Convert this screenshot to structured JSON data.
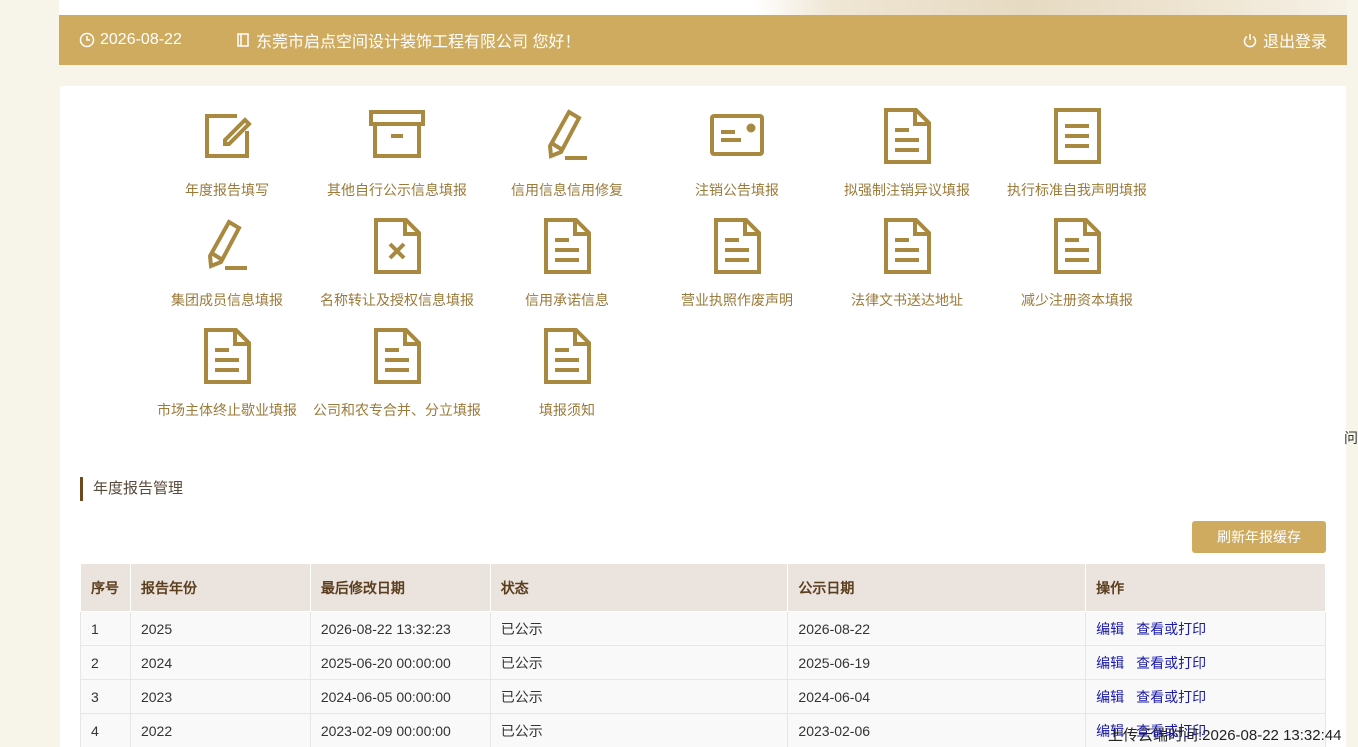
{
  "header": {
    "date": "2026-08-22",
    "company_greeting": "东莞市启点空间设计装饰工程有限公司 您好！",
    "logout_label": "退出登录",
    "background_color": "#cfab60"
  },
  "tiles": [
    {
      "label": "年度报告填写",
      "icon": "edit-icon"
    },
    {
      "label": "其他自行公示信息填报",
      "icon": "archive-icon"
    },
    {
      "label": "信用信息信用修复",
      "icon": "pencil-icon"
    },
    {
      "label": "注销公告填报",
      "icon": "card-icon"
    },
    {
      "label": "拟强制注销异议填报",
      "icon": "document-icon"
    },
    {
      "label": "执行标准自我声明填报",
      "icon": "document-icon"
    },
    {
      "label": "集团成员信息填报",
      "icon": "pencil-icon"
    },
    {
      "label": "名称转让及授权信息填报",
      "icon": "document-x-icon"
    },
    {
      "label": "信用承诺信息",
      "icon": "document-icon"
    },
    {
      "label": "营业执照作废声明",
      "icon": "document-icon"
    },
    {
      "label": "法律文书送达地址",
      "icon": "document-icon"
    },
    {
      "label": "减少注册资本填报",
      "icon": "document-icon"
    },
    {
      "label": "市场主体终止歇业填报",
      "icon": "document-icon"
    },
    {
      "label": "公司和农专合并、分立填报",
      "icon": "document-icon"
    },
    {
      "label": "填报须知",
      "icon": "document-icon"
    }
  ],
  "side_char": "问",
  "section": {
    "title": "年度报告管理",
    "refresh_label": "刷新年报缓存"
  },
  "table": {
    "headers": [
      "序号",
      "报告年份",
      "最后修改日期",
      "状态",
      "公示日期",
      "操作"
    ],
    "edit_label": "编辑",
    "view_label": "查看或打印",
    "rows": [
      {
        "no": "1",
        "year": "2025",
        "modified": "2026-08-22 13:32:23",
        "status": "已公示",
        "publish": "2026-08-22"
      },
      {
        "no": "2",
        "year": "2024",
        "modified": "2025-06-20 00:00:00",
        "status": "已公示",
        "publish": "2025-06-19"
      },
      {
        "no": "3",
        "year": "2023",
        "modified": "2024-06-05 00:00:00",
        "status": "已公示",
        "publish": "2024-06-04"
      },
      {
        "no": "4",
        "year": "2022",
        "modified": "2023-02-09 00:00:00",
        "status": "已公示",
        "publish": "2023-02-06"
      }
    ]
  },
  "upload_time": "上传云端时间:2026-08-22 13:32:44",
  "colors": {
    "accent": "#cfab60",
    "icon": "#a8893f",
    "link": "#1a1aa8"
  }
}
